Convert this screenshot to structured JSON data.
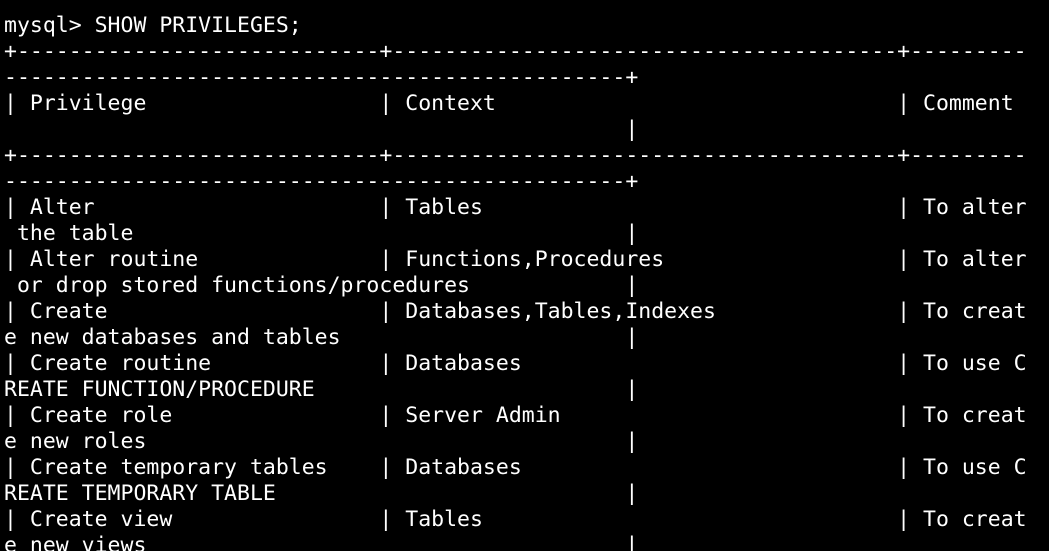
{
  "terminal": {
    "background": "#000000",
    "foreground": "#ffffff",
    "lines": [
      "mysql> SHOW PRIVILEGES;",
      "+----------------------------+---------------------------------------+---------",
      "------------------------------------------------+",
      "| Privilege                  | Context                               | Comment",
      "                                                |",
      "+----------------------------+---------------------------------------+---------",
      "------------------------------------------------+",
      "| Alter                      | Tables                                | To alter",
      " the table                                      |",
      "| Alter routine              | Functions,Procedures                  | To alter",
      " or drop stored functions/procedures            |",
      "| Create                     | Databases,Tables,Indexes              | To creat",
      "e new databases and tables                      |",
      "| Create routine             | Databases                             | To use C",
      "REATE FUNCTION/PROCEDURE                        |",
      "| Create role                | Server Admin                          | To creat",
      "e new roles                                     |",
      "| Create temporary tables    | Databases                             | To use C",
      "REATE TEMPORARY TABLE                           |",
      "| Create view                | Tables                                | To creat",
      "e new views                                     |"
    ]
  }
}
